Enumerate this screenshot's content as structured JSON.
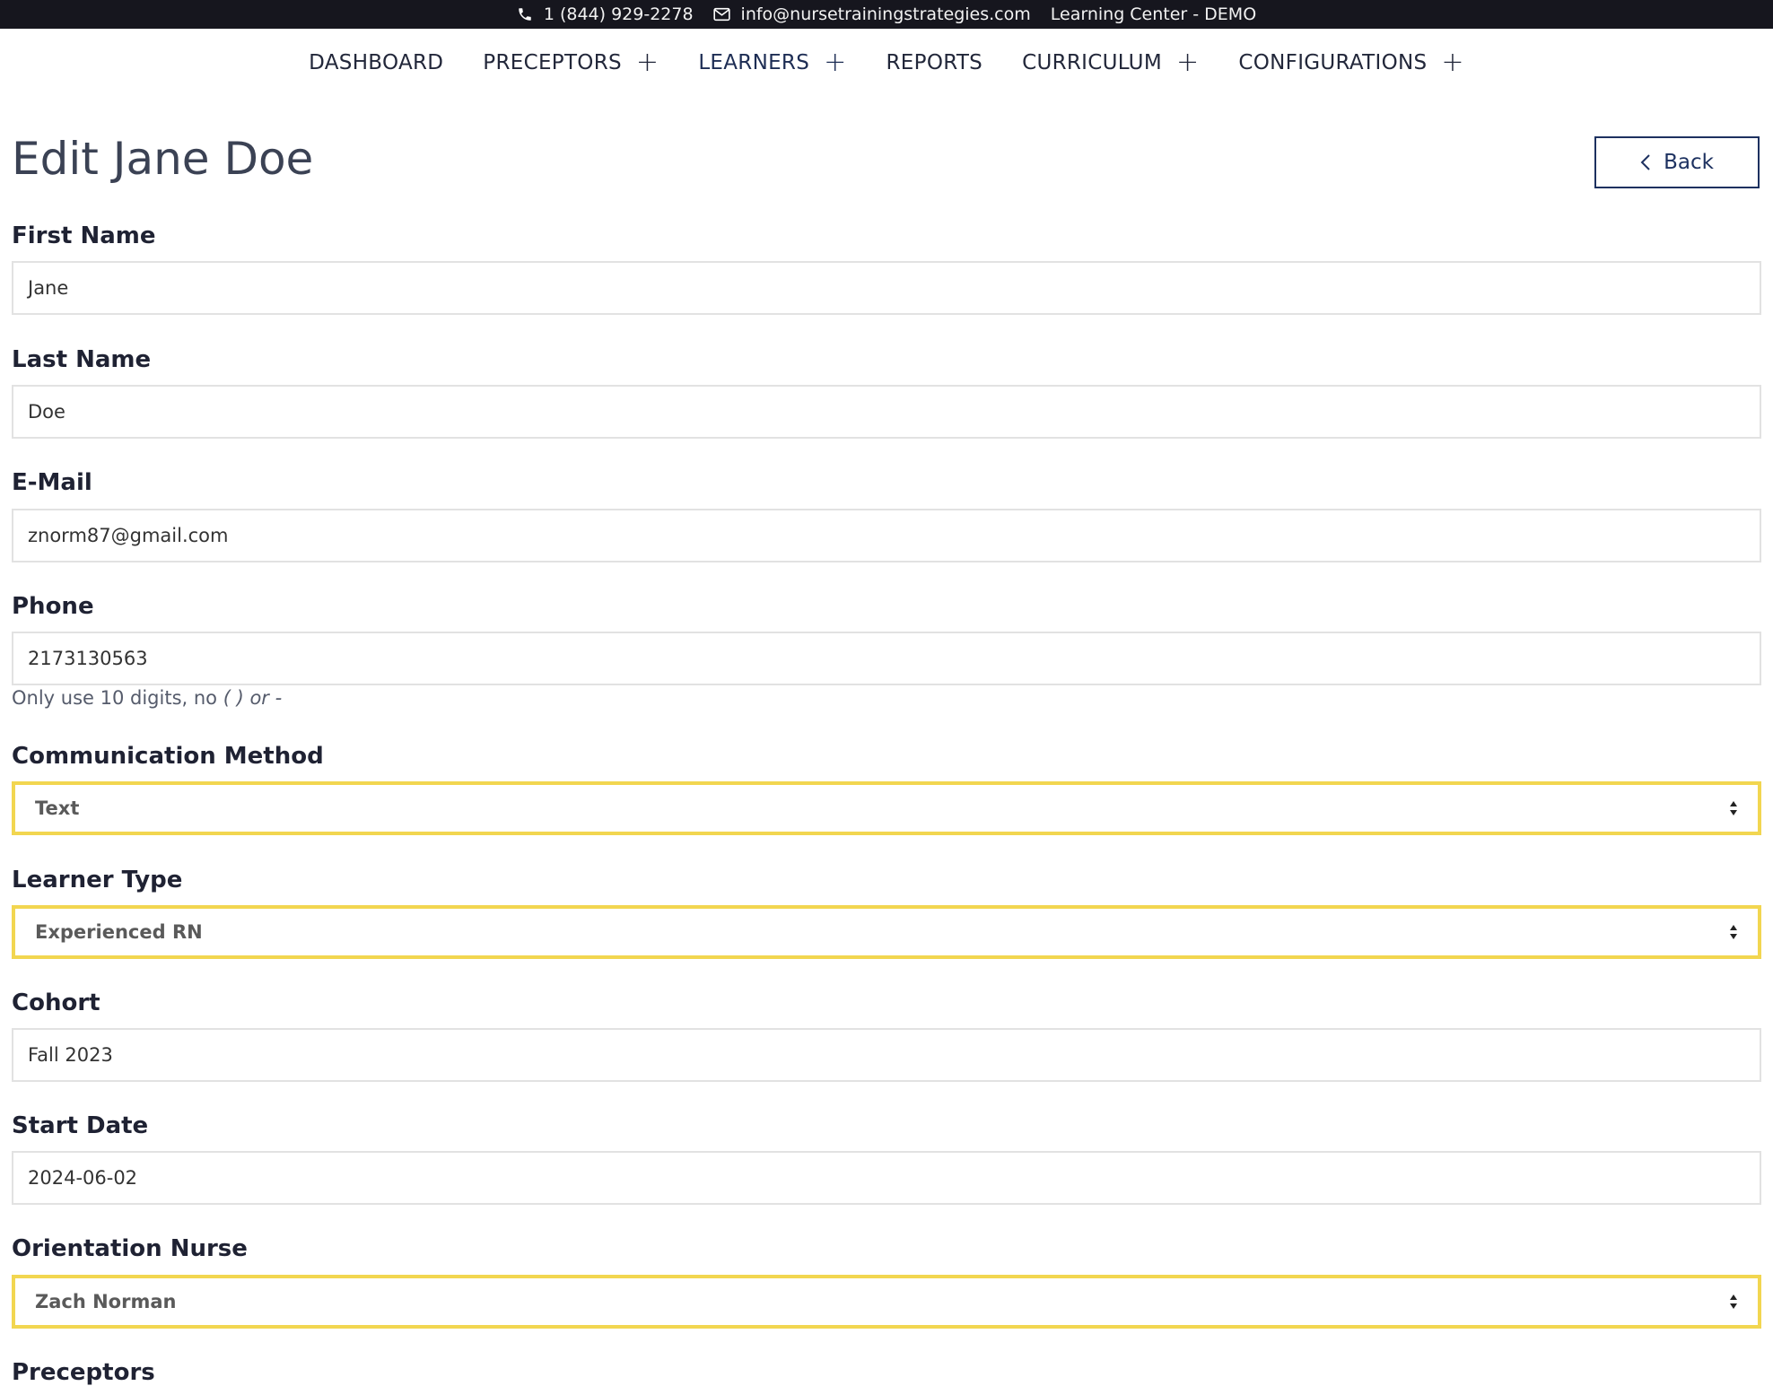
{
  "topbar": {
    "phone": "1 (844) 929-2278",
    "email": "info@nursetrainingstrategies.com",
    "site": "Learning Center - DEMO"
  },
  "nav": {
    "dashboard": "DASHBOARD",
    "preceptors": "PRECEPTORS",
    "learners": "LEARNERS",
    "reports": "REPORTS",
    "curriculum": "CURRICULUM",
    "configurations": "CONFIGURATIONS",
    "expand_symbol": "+",
    "active": "LEARNERS"
  },
  "page": {
    "title": "Edit Jane Doe",
    "back_label": "Back"
  },
  "form": {
    "first_name": {
      "label": "First Name",
      "value": "Jane"
    },
    "last_name": {
      "label": "Last Name",
      "value": "Doe"
    },
    "email": {
      "label": "E-Mail",
      "value": "znorm87@gmail.com"
    },
    "phone": {
      "label": "Phone",
      "value": "2173130563",
      "help_prefix": "Only use 10 digits, no ",
      "help_emph": "( ) or -"
    },
    "communication_method": {
      "label": "Communication Method",
      "selected": "Text"
    },
    "learner_type": {
      "label": "Learner Type",
      "selected": "Experienced RN"
    },
    "cohort": {
      "label": "Cohort",
      "value": "Fall 2023"
    },
    "start_date": {
      "label": "Start Date",
      "value": "2024-06-02"
    },
    "orientation_nurse": {
      "label": "Orientation Nurse",
      "selected": "Zach Norman"
    },
    "preceptors": {
      "label": "Preceptors"
    }
  },
  "colors": {
    "topbar_bg": "#16161e",
    "accent_navy": "#1d3160",
    "select_border": "#f2d650"
  }
}
